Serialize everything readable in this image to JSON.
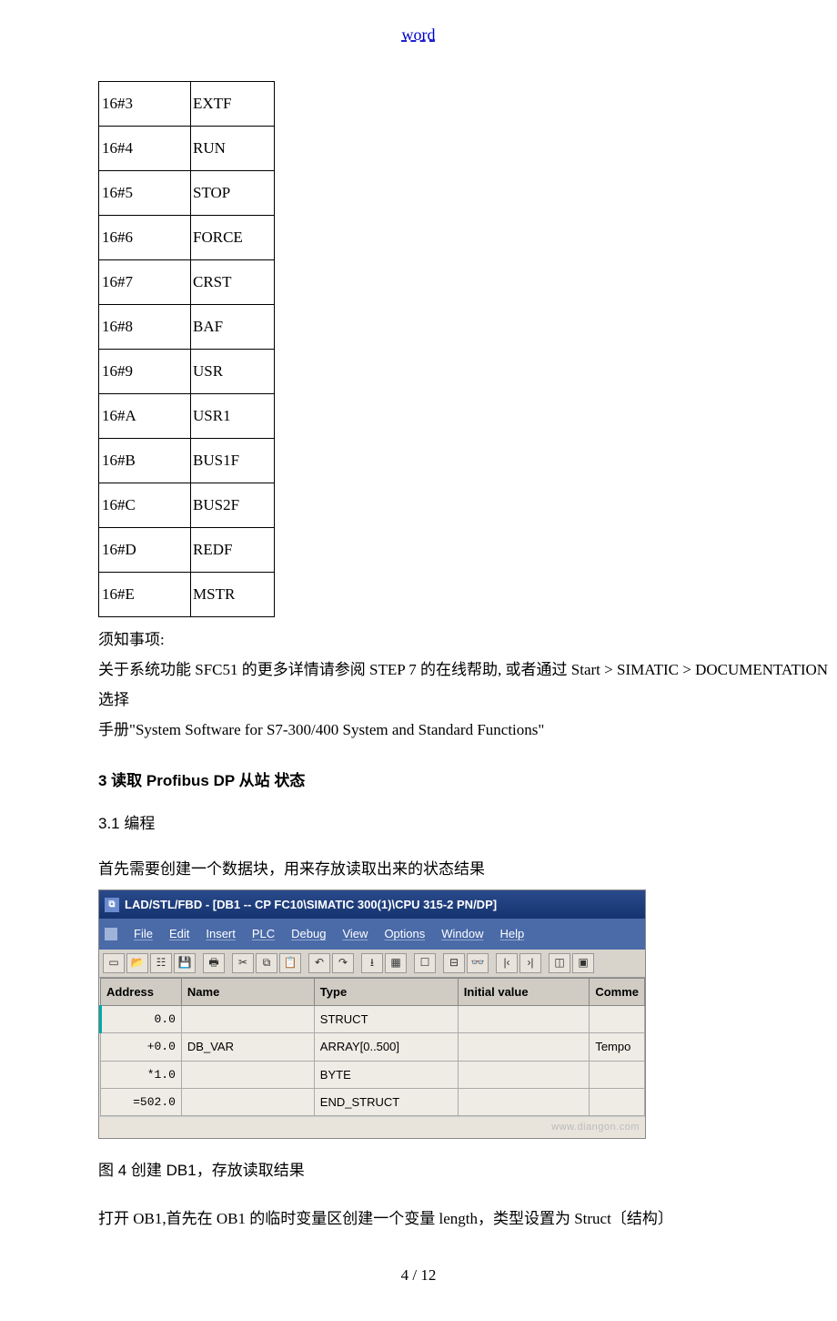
{
  "header": {
    "link": "word"
  },
  "codes": [
    {
      "key": "16#3",
      "val": "EXTF"
    },
    {
      "key": "16#4",
      "val": "RUN"
    },
    {
      "key": "16#5",
      "val": "STOP"
    },
    {
      "key": "16#6",
      "val": "FORCE"
    },
    {
      "key": "16#7",
      "val": "CRST"
    },
    {
      "key": "16#8",
      "val": "BAF"
    },
    {
      "key": "16#9",
      "val": "USR"
    },
    {
      "key": "16#A",
      "val": "USR1"
    },
    {
      "key": "16#B",
      "val": "BUS1F"
    },
    {
      "key": "16#C",
      "val": "BUS2F"
    },
    {
      "key": "16#D",
      "val": "REDF"
    },
    {
      "key": "16#E",
      "val": "MSTR"
    }
  ],
  "text": {
    "note_title": "须知事项:",
    "note_body1": "关于系统功能 SFC51 的更多详情请参阅 STEP 7 的在线帮助, 或者通过 Start > SIMATIC > DOCUMENTATION 选择",
    "note_body2": "手册\"System Software for S7-300/400 System and Standard Functions\"",
    "section3": "3 读取 Profibus DP 从站 状态",
    "sub31": "3.1 编程",
    "sub31_line": "首先需要创建一个数据块，用来存放读取出来的状态结果",
    "fig4": "图 4  创建 DB1，存放读取结果",
    "after_fig": "打开 OB1,首先在 OB1 的临时变量区创建一个变量 length，类型设置为 Struct〔结构〕"
  },
  "screenshot": {
    "title": "LAD/STL/FBD  - [DB1 -- CP FC10\\SIMATIC 300(1)\\CPU 315-2 PN/DP]",
    "menu": [
      "File",
      "Edit",
      "Insert",
      "PLC",
      "Debug",
      "View",
      "Options",
      "Window",
      "Help"
    ],
    "grid": {
      "headers": [
        "Address",
        "Name",
        "Type",
        "Initial value",
        "Comme"
      ],
      "rows": [
        {
          "addr": "0.0",
          "name": "",
          "type": "STRUCT",
          "init": "",
          "comm": ""
        },
        {
          "addr": "+0.0",
          "name": "DB_VAR",
          "type": "ARRAY[0..500]",
          "init": "",
          "comm": "Tempo"
        },
        {
          "addr": "*1.0",
          "name": "",
          "type": "BYTE",
          "init": "",
          "comm": ""
        },
        {
          "addr": "=502.0",
          "name": "",
          "type": "END_STRUCT",
          "init": "",
          "comm": ""
        }
      ]
    },
    "watermark": "www.diangon.com"
  },
  "footer": {
    "page": "4 / 12"
  }
}
